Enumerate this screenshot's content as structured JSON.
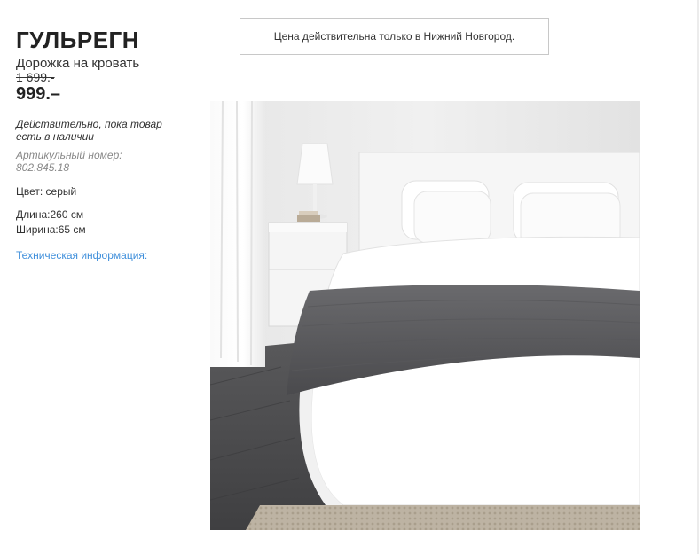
{
  "product": {
    "name": "ГУЛЬРЕГН",
    "description": "Дорожка на кровать",
    "old_price": "1 699.-",
    "price": "999.–",
    "availability": "Действительно, пока товар есть в наличии",
    "article": "Артикульный номер: 802.845.18",
    "color": "Цвет: серый",
    "length": "Длина:260 см",
    "width": "Ширина:65 см",
    "tech_info_link": "Техническая информация:"
  },
  "notice": {
    "text": "Цена действительна только в Нижний Новгород."
  },
  "colors": {
    "link": "#3f8fdb",
    "text": "#333333",
    "muted": "#888888",
    "border": "#c8c8c8",
    "bed_runner": "#5b5b5e",
    "floor": "#4f4f51"
  }
}
